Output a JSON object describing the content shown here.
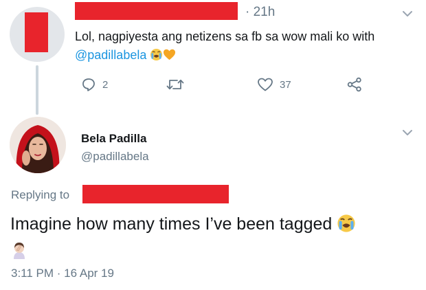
{
  "parent_tweet": {
    "time": "· 21h",
    "text": "Lol, nagpiyesta ang netizens sa fb sa wow mali ko with",
    "mention": "@padillabela",
    "actions": {
      "reply_count": "2",
      "retweet_count": "",
      "like_count": "37"
    }
  },
  "reply_tweet": {
    "display_name": "Bela Padilla",
    "handle": "@padillabela",
    "replying_to_label": "Replying to",
    "text": "Imagine how many times I’ve been tagged",
    "timestamp": "3:11 PM · 16 Apr 19"
  },
  "colors": {
    "redaction": "#e8242c",
    "link": "#1b95e0",
    "muted": "#657786"
  },
  "icons": [
    "reply-icon",
    "retweet-icon",
    "like-icon",
    "share-icon",
    "chevron-down-icon",
    "crying-face-emoji",
    "orange-heart-emoji",
    "facepalm-emoji"
  ]
}
